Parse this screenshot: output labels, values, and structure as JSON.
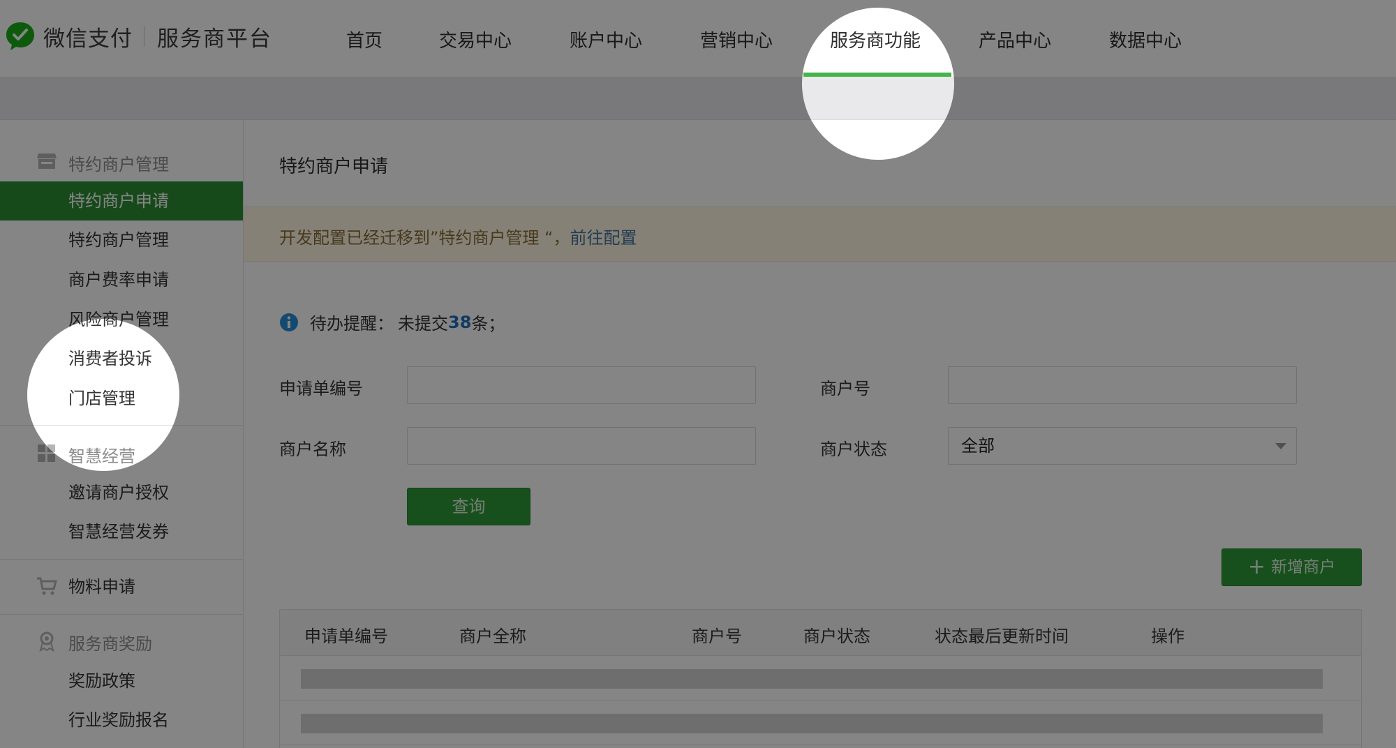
{
  "header": {
    "brand": "微信支付",
    "platform": "服务商平台",
    "nav": [
      {
        "label": "首页"
      },
      {
        "label": "交易中心"
      },
      {
        "label": "账户中心"
      },
      {
        "label": "营销中心"
      },
      {
        "label": "服务商功能",
        "active": true
      },
      {
        "label": "产品中心"
      },
      {
        "label": "数据中心"
      }
    ]
  },
  "sidebar": {
    "groups": [
      {
        "title": "特约商户管理",
        "icon": "store-icon",
        "items": [
          {
            "label": "特约商户申请",
            "active": true
          },
          {
            "label": "特约商户管理"
          },
          {
            "label": "商户费率申请"
          },
          {
            "label": "风险商户管理"
          },
          {
            "label": "消费者投诉"
          },
          {
            "label": "门店管理"
          }
        ]
      },
      {
        "title": "智慧经营",
        "icon": "grid-icon",
        "items": [
          {
            "label": "邀请商户授权"
          },
          {
            "label": "智慧经营发券"
          }
        ]
      },
      {
        "title": "物料申请",
        "icon": "cart-icon",
        "items": []
      },
      {
        "title": "服务商奖励",
        "icon": "award-icon",
        "items": [
          {
            "label": "奖励政策"
          },
          {
            "label": "行业奖励报名"
          }
        ]
      }
    ]
  },
  "main": {
    "title": "特约商户申请",
    "notice": {
      "text": "开发配置已经迁移到”特约商户管理 “，",
      "link": "前往配置"
    },
    "reminder": {
      "label": "待办提醒：",
      "prefix": "未提交",
      "count": "38",
      "suffix": "条；"
    },
    "form": {
      "application_no_label": "申请单编号",
      "application_no_value": "",
      "merchant_id_label": "商户号",
      "merchant_id_value": "",
      "merchant_name_label": "商户名称",
      "merchant_name_value": "",
      "merchant_status_label": "商户状态",
      "merchant_status_value": "全部",
      "query_button": "查询"
    },
    "add_button": "新增商户",
    "table": {
      "columns": [
        "申请单编号",
        "商户全称",
        "商户号",
        "商户状态",
        "状态最后更新时间",
        "操作"
      ]
    }
  },
  "colors": {
    "accent": "#44b549",
    "active_bg": "#2c8f35",
    "link": "#44739f",
    "count": "#1f6fbf"
  }
}
